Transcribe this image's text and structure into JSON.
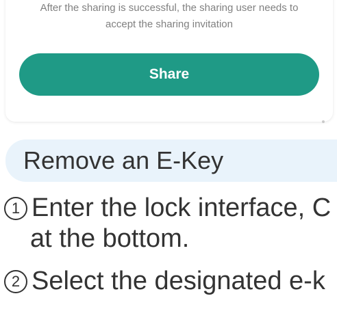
{
  "share_card": {
    "note_line1": "After the sharing is successful, the sharing user needs to",
    "note_line2": "accept the sharing invitation",
    "share_label": "Share"
  },
  "section": {
    "title": "Remove an E-Key"
  },
  "steps": [
    {
      "number": "1",
      "text_line1": "Enter the lock interface, C",
      "text_line2": "at the bottom."
    },
    {
      "number": "2",
      "text_line1": "Select the designated e-k"
    }
  ],
  "colors": {
    "accent": "#1f9a86",
    "banner": "#e9f3fb",
    "text": "#333333",
    "muted": "#808080"
  }
}
